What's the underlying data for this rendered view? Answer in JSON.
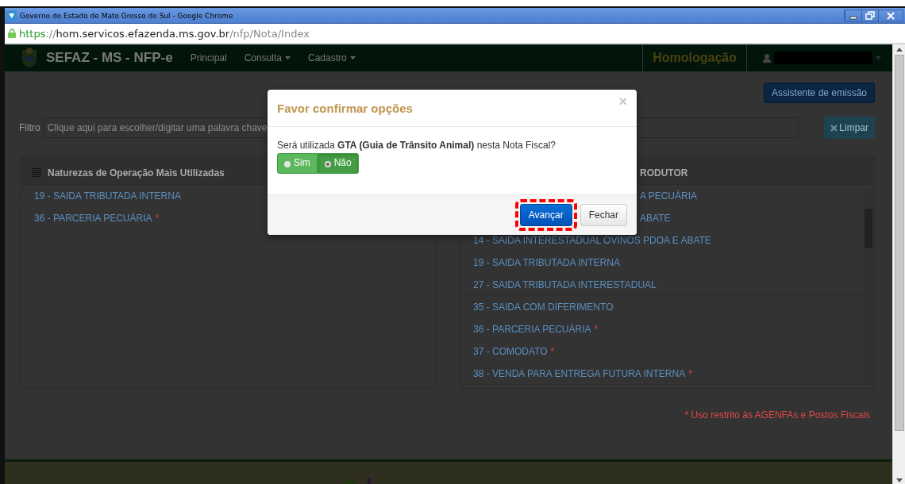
{
  "browser": {
    "title": "Governo do Estado de Mato Grosso do Sul - Google Chrome",
    "url_scheme": "https",
    "url_separator": "://",
    "url_host": "hom.servicos.efazenda.ms.gov.br",
    "url_path": "/nfp/Nota/Index"
  },
  "navbar": {
    "brand": "SEFAZ - MS - NFP-e",
    "menu": [
      {
        "label": "Principal",
        "dropdown": false
      },
      {
        "label": "Consulta",
        "dropdown": true
      },
      {
        "label": "Cadastro",
        "dropdown": true
      }
    ],
    "environment": "Homologação"
  },
  "toolbar": {
    "assistant_button": "Assistente de emissão"
  },
  "filter": {
    "label": "Filtro",
    "placeholder": "Clique aqui para escolher/digitar uma palavra chave",
    "clear_button": "Limpar"
  },
  "left_panel": {
    "title": "Naturezas de Operação Mais Utilizadas",
    "items": [
      {
        "label": "19 - SAIDA TRIBUTADA INTERNA"
      },
      {
        "label": "36 - PARCERIA PECUÁRIA",
        "note_mark": "*"
      }
    ]
  },
  "right_panel": {
    "title": "RODUTOR",
    "items": [
      {
        "kind": "cut",
        "label": "A PECUÁRIA"
      },
      {
        "kind": "cut",
        "label": "ABATE"
      },
      {
        "kind": "full",
        "label": "14 - SAIDA INTERESTADUAL OVINOS PDOA E ABATE"
      },
      {
        "kind": "full",
        "label": "19 - SAIDA TRIBUTADA INTERNA"
      },
      {
        "kind": "full",
        "label": "27 - SAIDA TRIBUTADA INTERESTADUAL"
      },
      {
        "kind": "full",
        "label": "35 - SAIDA COM DIFERIMENTO"
      },
      {
        "kind": "full",
        "label": "36 - PARCERIA PECUÁRIA",
        "note_mark": "*"
      },
      {
        "kind": "full",
        "label": "37 - COMODATO",
        "note_mark": "*"
      },
      {
        "kind": "full",
        "label": "38 - VENDA PARA ENTREGA FUTURA INTERNA",
        "note_mark": "*"
      }
    ]
  },
  "footnote": "* Uso restrito às AGENFAs e Postos Fiscais",
  "modal": {
    "title": "Favor confirmar opções",
    "close": "×",
    "question": "Será utilizada **GTA (Guia de Trânsito Animal)** nesta Nota Fiscal?",
    "options": [
      {
        "label": "Sim",
        "selected": false
      },
      {
        "label": "Não",
        "selected": true
      }
    ],
    "buttons": [
      {
        "label": "Avançar",
        "kind": "primary",
        "highlighted": true
      },
      {
        "label": "Fechar",
        "kind": "default",
        "highlighted": false
      }
    ]
  }
}
